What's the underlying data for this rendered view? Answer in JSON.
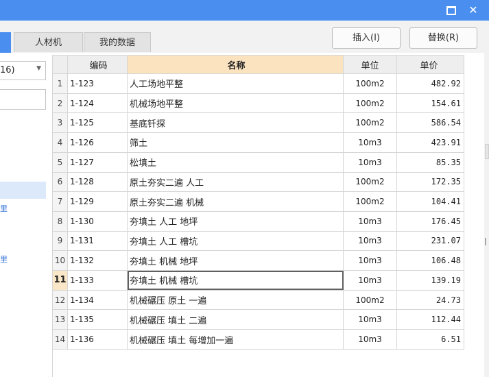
{
  "window": {
    "maximize_icon": "maximize-icon",
    "close_icon": "close-icon",
    "close_glyph": "✕",
    "accent_color": "#4a8ff0"
  },
  "tabs": [
    {
      "label": "人材机"
    },
    {
      "label": "我的数据"
    }
  ],
  "buttons": {
    "insert": "插入(I)",
    "replace": "替换(R)"
  },
  "left_panel": {
    "dropdown_value": "16)",
    "dropdown_arrow": "▼",
    "tree_mark": "里"
  },
  "table": {
    "headers": {
      "code": "编码",
      "name": "名称",
      "unit": "单位",
      "price": "单价"
    },
    "current_row_index": 10,
    "rows": [
      {
        "no": "1",
        "code": "1-123",
        "name": "人工场地平整",
        "unit": "100m2",
        "price": "482.92"
      },
      {
        "no": "2",
        "code": "1-124",
        "name": "机械场地平整",
        "unit": "100m2",
        "price": "154.61"
      },
      {
        "no": "3",
        "code": "1-125",
        "name": "基底钎探",
        "unit": "100m2",
        "price": "586.54"
      },
      {
        "no": "4",
        "code": "1-126",
        "name": "筛土",
        "unit": "10m3",
        "price": "423.91"
      },
      {
        "no": "5",
        "code": "1-127",
        "name": "松填土",
        "unit": "10m3",
        "price": "85.35"
      },
      {
        "no": "6",
        "code": "1-128",
        "name": "原土夯实二遍 人工",
        "unit": "100m2",
        "price": "172.35"
      },
      {
        "no": "7",
        "code": "1-129",
        "name": "原土夯实二遍 机械",
        "unit": "100m2",
        "price": "104.41"
      },
      {
        "no": "8",
        "code": "1-130",
        "name": "夯填土 人工 地坪",
        "unit": "10m3",
        "price": "176.45"
      },
      {
        "no": "9",
        "code": "1-131",
        "name": "夯填土 人工 槽坑",
        "unit": "10m3",
        "price": "231.07"
      },
      {
        "no": "10",
        "code": "1-132",
        "name": "夯填土 机械 地坪",
        "unit": "10m3",
        "price": "106.48"
      },
      {
        "no": "11",
        "code": "1-133",
        "name": "夯填土 机械 槽坑",
        "unit": "10m3",
        "price": "139.19"
      },
      {
        "no": "12",
        "code": "1-134",
        "name": "机械碾压 原土 一遍",
        "unit": "100m2",
        "price": "24.73"
      },
      {
        "no": "13",
        "code": "1-135",
        "name": "机械碾压 填土 二遍",
        "unit": "10m3",
        "price": "112.44"
      },
      {
        "no": "14",
        "code": "1-136",
        "name": "机械碾压 填土 每增加一遍",
        "unit": "10m3",
        "price": "6.51"
      }
    ]
  }
}
